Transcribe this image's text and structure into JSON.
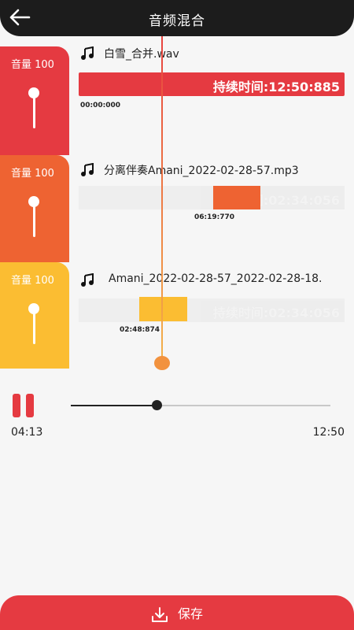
{
  "header": {
    "title": "音频混合"
  },
  "tracks": [
    {
      "volume_label": "音量 100",
      "volume": 100,
      "name": "白雪_合并.wav",
      "duration_label": "持续时间:12:50:885",
      "start_time": "00:00:000",
      "color": "#e53a41"
    },
    {
      "volume_label": "音量 100",
      "volume": 100,
      "name": "分离伴奏Amani_2022-02-28-57.mp3",
      "duration_label": "持续时间:02:34:056",
      "start_time": "06:19:770",
      "color": "#ee6332"
    },
    {
      "volume_label": "音量 100",
      "volume": 100,
      "name": "Amani_2022-02-28-57_2022-02-28-18.",
      "duration_label": "持续时间:02:34:056",
      "start_time": "02:48:874",
      "color": "#fbbd32"
    }
  ],
  "player": {
    "current_time": "04:13",
    "total_time": "12:50",
    "progress_fraction": 0.33
  },
  "footer": {
    "save_label": "保存"
  },
  "colors": {
    "header": "#1c1c1c",
    "accent": "#e53a41",
    "playhead": "#f2923e"
  }
}
